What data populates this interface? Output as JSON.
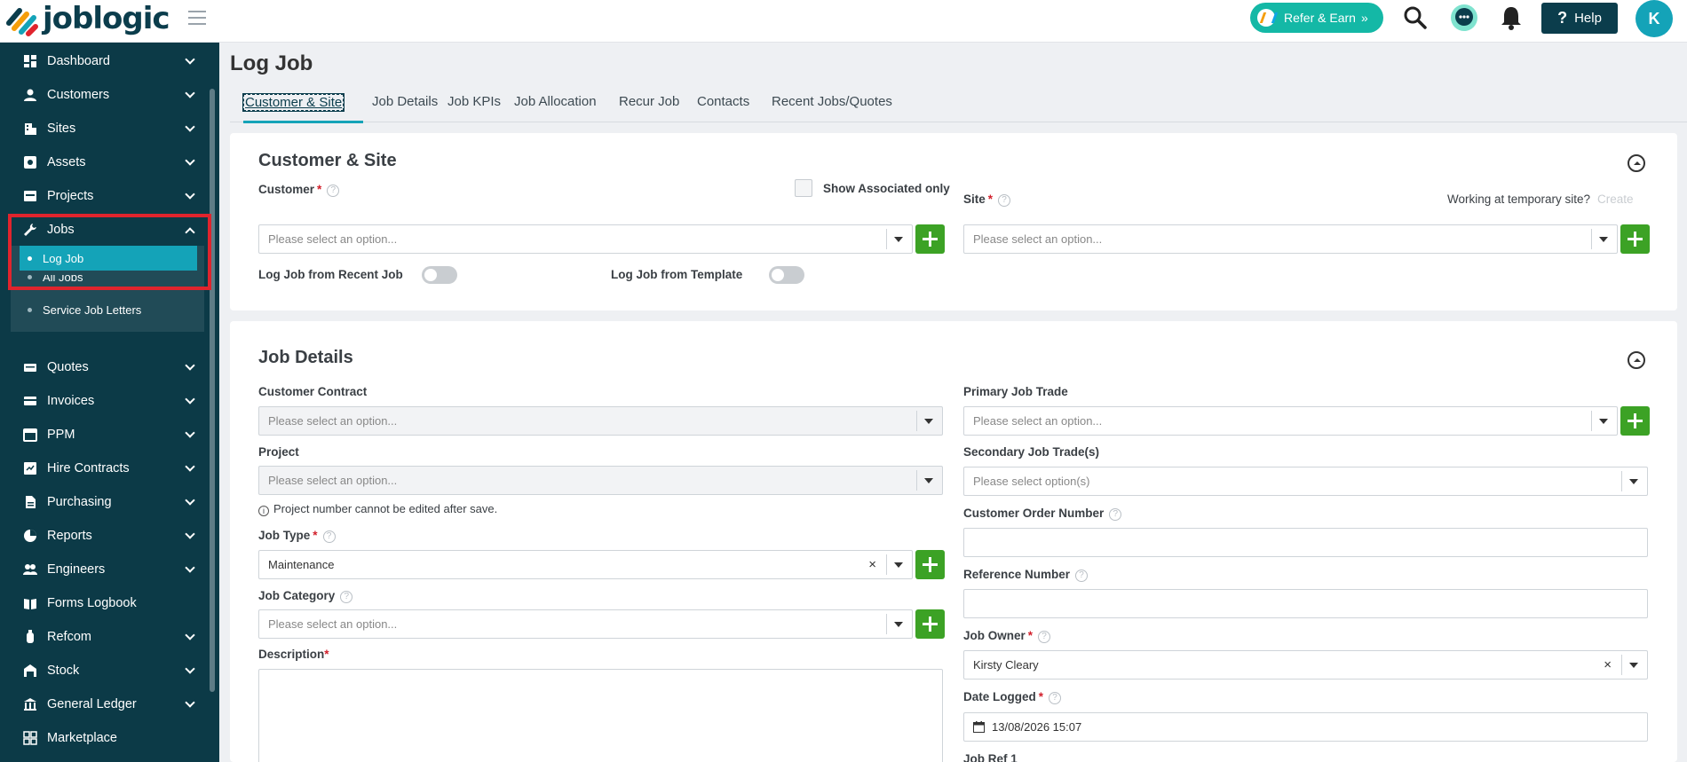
{
  "app": {
    "name": "joblogic"
  },
  "topbar": {
    "refer_label": "Refer & Earn",
    "help_label": "Help",
    "avatar_initial": "K"
  },
  "sidebar": {
    "items": [
      {
        "label": "Dashboard",
        "icon": "dashboard-icon"
      },
      {
        "label": "Customers",
        "icon": "person-icon"
      },
      {
        "label": "Sites",
        "icon": "building-icon"
      },
      {
        "label": "Assets",
        "icon": "asset-icon"
      },
      {
        "label": "Projects",
        "icon": "projects-icon"
      },
      {
        "label": "Jobs",
        "icon": "wrench-icon"
      },
      {
        "label": "Quotes",
        "icon": "quotes-icon"
      },
      {
        "label": "Invoices",
        "icon": "invoice-icon"
      },
      {
        "label": "PPM",
        "icon": "calendar-icon"
      },
      {
        "label": "Hire Contracts",
        "icon": "contract-icon"
      },
      {
        "label": "Purchasing",
        "icon": "document-icon"
      },
      {
        "label": "Reports",
        "icon": "pie-chart-icon"
      },
      {
        "label": "Engineers",
        "icon": "people-icon"
      },
      {
        "label": "Forms Logbook",
        "icon": "book-icon"
      },
      {
        "label": "Refcom",
        "icon": "cylinder-icon"
      },
      {
        "label": "Stock",
        "icon": "warehouse-icon"
      },
      {
        "label": "General Ledger",
        "icon": "bank-icon"
      },
      {
        "label": "Marketplace",
        "icon": "grid-icon"
      }
    ],
    "jobs_sub": [
      {
        "label": "Log Job"
      },
      {
        "label": "All Jobs"
      },
      {
        "label": "Service Job Letters"
      }
    ]
  },
  "page": {
    "title": "Log Job",
    "tabs": [
      {
        "label": "Customer & Site"
      },
      {
        "label": "Job Details"
      },
      {
        "label": "Job KPIs"
      },
      {
        "label": "Job Allocation"
      },
      {
        "label": "Recur Job"
      },
      {
        "label": "Contacts"
      },
      {
        "label": "Recent Jobs/Quotes"
      }
    ]
  },
  "customer_site": {
    "title": "Customer & Site",
    "customer_label": "Customer",
    "show_associated_label": "Show Associated only",
    "site_label": "Site",
    "temp_site_label": "Working at temporary site?",
    "create_label": "Create",
    "customer_placeholder": "Please select an option...",
    "site_placeholder": "Please select an option...",
    "recent_job_label": "Log Job from Recent Job",
    "template_label": "Log Job from Template"
  },
  "job_details": {
    "title": "Job Details",
    "customer_contract_label": "Customer Contract",
    "customer_contract_placeholder": "Please select an option...",
    "project_label": "Project",
    "project_placeholder": "Please select an option...",
    "project_note": "Project number cannot be edited after save.",
    "job_type_label": "Job Type",
    "job_type_value": "Maintenance",
    "job_category_label": "Job Category",
    "job_category_placeholder": "Please select an option...",
    "description_label": "Description",
    "primary_trade_label": "Primary Job Trade",
    "primary_trade_placeholder": "Please select an option...",
    "secondary_trade_label": "Secondary Job Trade(s)",
    "secondary_trade_placeholder": "Please select option(s)",
    "order_number_label": "Customer Order Number",
    "reference_label": "Reference Number",
    "job_owner_label": "Job Owner",
    "job_owner_value": "Kirsty Cleary",
    "date_logged_label": "Date Logged",
    "date_logged_value": "13/08/2026 15:07",
    "job_ref_label": "Job Ref 1"
  },
  "colors": {
    "sidebar": "#0c3a47",
    "accent": "#14a3b8",
    "add": "#3ca225",
    "highlight": "#e0242d"
  }
}
